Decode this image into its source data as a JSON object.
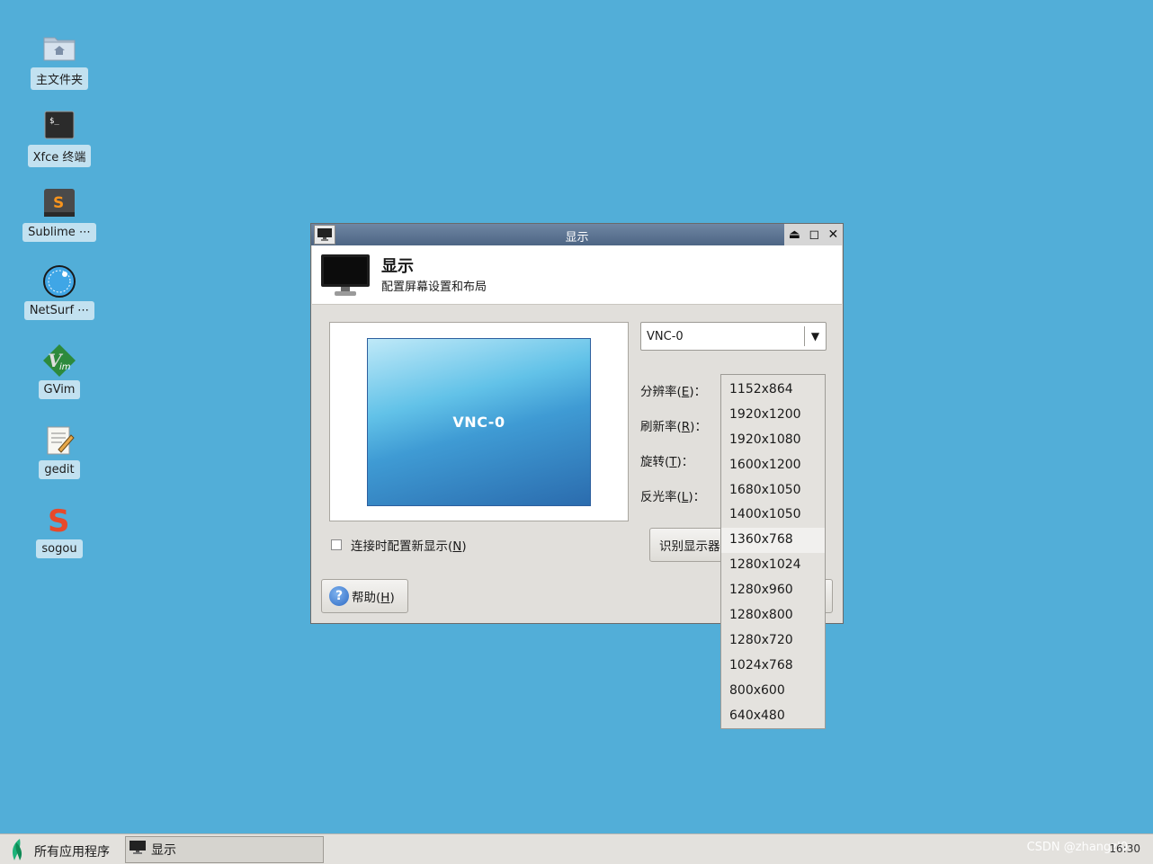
{
  "desktop": {
    "icons": [
      {
        "label": "主文件夹",
        "icon": "home-folder-icon"
      },
      {
        "label": "Xfce 终端",
        "icon": "terminal-icon"
      },
      {
        "label": "Sublime ⋯",
        "icon": "sublime-icon"
      },
      {
        "label": "NetSurf ⋯",
        "icon": "netsurf-globe-icon"
      },
      {
        "label": "GVim",
        "icon": "gvim-icon"
      },
      {
        "label": "gedit",
        "icon": "gedit-icon"
      },
      {
        "label": "sogou",
        "icon": "sogou-icon"
      }
    ],
    "background_color": "#52aed8"
  },
  "window": {
    "title": "显示",
    "header_title": "显示",
    "header_subtitle": "配置屏幕设置和布局",
    "preview_monitor_label": "VNC-0",
    "display_select_value": "VNC-0",
    "fields": {
      "resolution": {
        "text": "分辨率(",
        "key": "E",
        "end": ")："
      },
      "refresh": {
        "text": "刷新率(",
        "key": "R",
        "end": ")："
      },
      "rotation": {
        "text": "旋转(",
        "key": "T",
        "end": ")："
      },
      "reflection": {
        "text": "反光率(",
        "key": "L",
        "end": ")："
      }
    },
    "checkbox": {
      "text": "连接时配置新显示(",
      "key": "N",
      "end": ")"
    },
    "identify_button": "识别显示器",
    "help_button": {
      "text": "帮助(",
      "key": "H",
      "end": ")"
    }
  },
  "resolution_options": [
    "1152x864",
    "1920x1200",
    "1920x1080",
    "1600x1200",
    "1680x1050",
    "1400x1050",
    "1360x768",
    "1280x1024",
    "1280x960",
    "1280x800",
    "1280x720",
    "1024x768",
    "800x600",
    "640x480"
  ],
  "highlighted_option": "1360x768",
  "taskbar": {
    "start_label": "所有应用程序",
    "task_label": "显示",
    "watermark": "CSDN @zhangzl0",
    "clock": "16:30"
  }
}
